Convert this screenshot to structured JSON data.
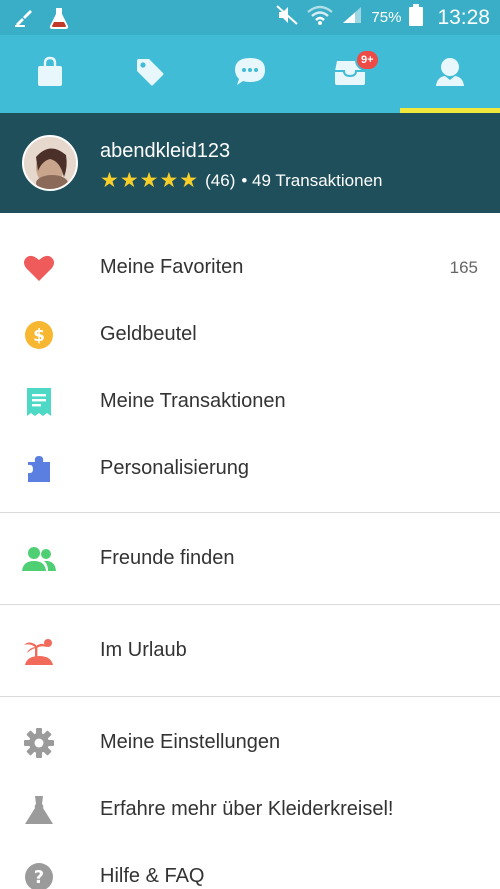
{
  "status_bar": {
    "battery": "75%",
    "time": "13:28"
  },
  "tabs": [
    {
      "name": "shop"
    },
    {
      "name": "sell"
    },
    {
      "name": "messages"
    },
    {
      "name": "inbox",
      "badge": "9+"
    },
    {
      "name": "profile",
      "active": true
    }
  ],
  "profile": {
    "username": "abendkleid123",
    "stars": "★★★★★",
    "reviews": "(46)",
    "transactions": "• 49 Transaktionen"
  },
  "menu": {
    "favorites": {
      "label": "Meine Favoriten",
      "count": "165"
    },
    "wallet": {
      "label": "Geldbeutel"
    },
    "transactions": {
      "label": "Meine Transaktionen"
    },
    "personalization": {
      "label": "Personalisierung"
    },
    "find_friends": {
      "label": "Freunde finden"
    },
    "vacation": {
      "label": "Im Urlaub"
    },
    "settings": {
      "label": "Meine Einstellungen"
    },
    "about": {
      "label": "Erfahre mehr über Kleiderkreisel!"
    },
    "help": {
      "label": "Hilfe & FAQ"
    }
  },
  "colors": {
    "status_bar": "#3aaec6",
    "tab_bar": "#41bcd6",
    "active_indicator": "#f3e93c",
    "profile_bg": "#1e4f5b",
    "star": "#f7cf2a",
    "heart": "#ef5a5a",
    "coin": "#f7b731",
    "receipt": "#4dd9c5",
    "puzzle": "#5b7fe0",
    "friends": "#4fcf74",
    "island": "#f26b5a",
    "gray_icon": "#9b9b9b"
  }
}
